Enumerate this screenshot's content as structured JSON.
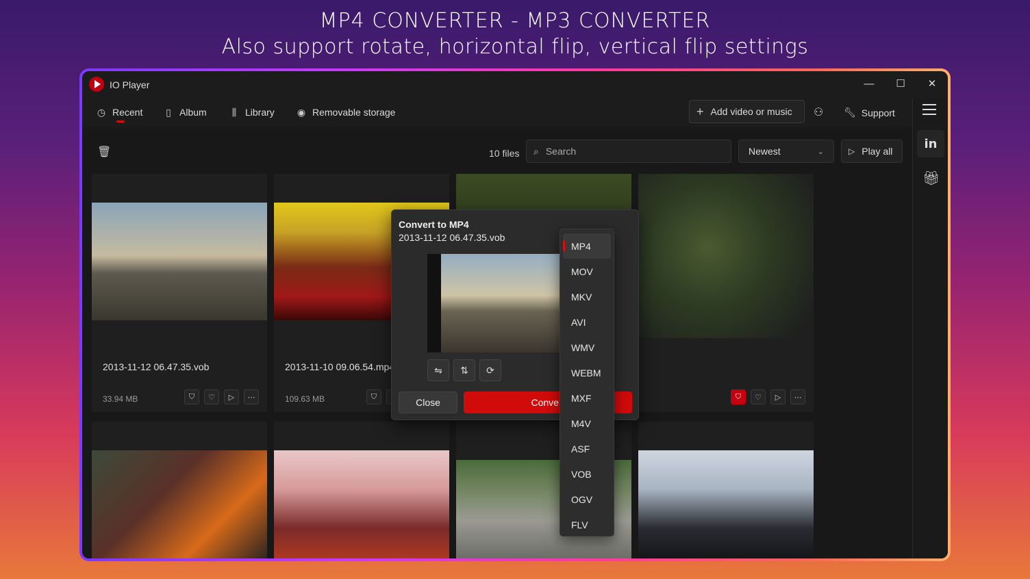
{
  "headline": {
    "line1": "MP4 CONVERTER - MP3 CONVERTER",
    "line2": "Also support rotate, horizontal flip, vertical flip settings"
  },
  "app": {
    "title": "IO Player",
    "window_controls": {
      "minimize": "—",
      "maximize": "☐",
      "close": "✕"
    }
  },
  "nav": {
    "items": [
      {
        "label": "Recent",
        "icon": "clock-icon"
      },
      {
        "label": "Album",
        "icon": "album-icon"
      },
      {
        "label": "Library",
        "icon": "library-icon"
      },
      {
        "label": "Removable storage",
        "icon": "disc-icon"
      }
    ],
    "add_label": "Add video or music",
    "support_label": "Support"
  },
  "toolbar": {
    "files_count": "10 files",
    "search_placeholder": "Search",
    "sort_value": "Newest",
    "play_all": "Play all"
  },
  "cards": [
    {
      "name": "2013-11-12 06.47.35.vob",
      "size": "33.94 MB"
    },
    {
      "name": "2013-11-10 09.06.54.mp4",
      "size": "109.63 MB"
    },
    {
      "name": "",
      "size": ""
    },
    {
      "name": "",
      "size": ""
    }
  ],
  "dialog": {
    "title": "Convert to MP4",
    "file": "2013-11-12 06.47.35.vob",
    "close_label": "Close",
    "convert_label": "Convert"
  },
  "formats": {
    "selected": "MP4",
    "options": [
      "MP4",
      "MOV",
      "MKV",
      "AVI",
      "WMV",
      "WEBM",
      "MXF",
      "M4V",
      "ASF",
      "VOB",
      "OGV",
      "FLV"
    ]
  },
  "colors": {
    "accent": "#d10a0a",
    "background": "#1c1c1c"
  }
}
